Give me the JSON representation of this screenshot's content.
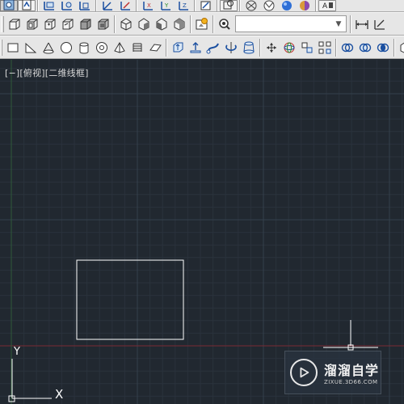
{
  "viewport": {
    "label": "[−][俯视][二维线框]",
    "ucs_y_label": "Y",
    "ucs_x_label": "X"
  },
  "watermark": {
    "brand": "溜溜自学",
    "url": "ZIXUE.3D66.COM"
  },
  "toolbar": {
    "visual_style_combo_value": ""
  },
  "colors": {
    "canvas_bg": "#212830",
    "grid_minor": "#2a323c",
    "grid_major": "#34404c",
    "x_axis": "#7a2a34",
    "y_axis": "#2e5a3a",
    "object_white": "#ffffff",
    "toolbar_bg": "#e6e6e6"
  }
}
